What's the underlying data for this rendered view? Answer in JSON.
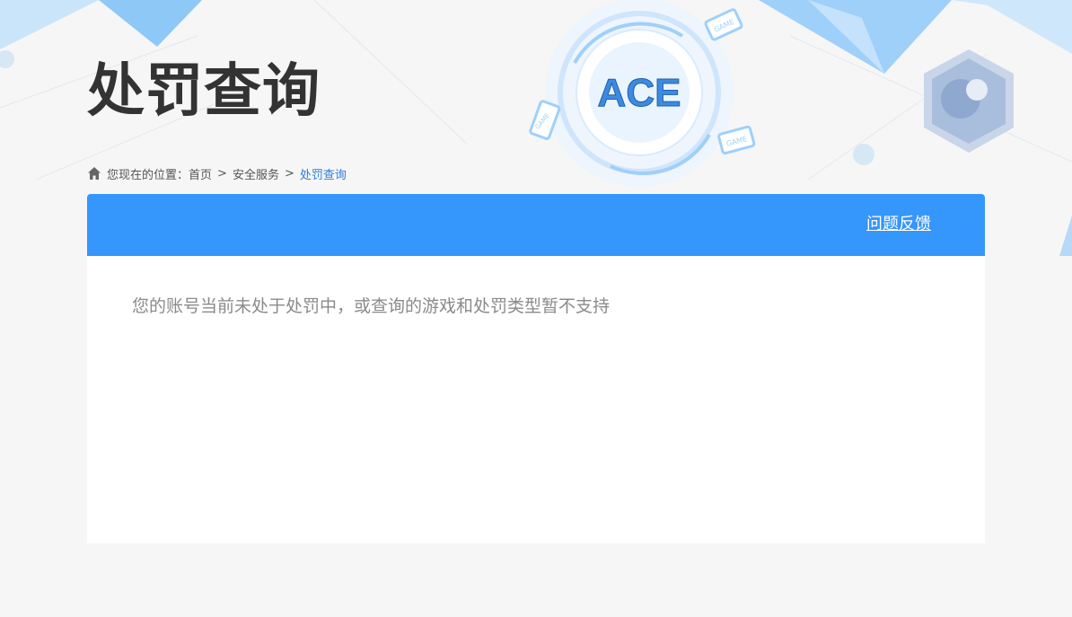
{
  "page": {
    "title": "处罚查询"
  },
  "breadcrumb": {
    "prefix": "您现在的位置：",
    "items": [
      "首页",
      "安全服务",
      "处罚查询"
    ],
    "separator": ">"
  },
  "panel": {
    "feedback_label": "问题反馈",
    "message": "您的账号当前未处于处罚中，或查询的游戏和处罚类型暂不支持"
  },
  "decor": {
    "logo_text": "ACE",
    "game_tag": "GAME"
  },
  "colors": {
    "header_blue": "#3596fc",
    "title": "#333333",
    "breadcrumb_current": "#2a7fd6",
    "message": "#8a8a8a",
    "background": "#f6f6f6"
  }
}
